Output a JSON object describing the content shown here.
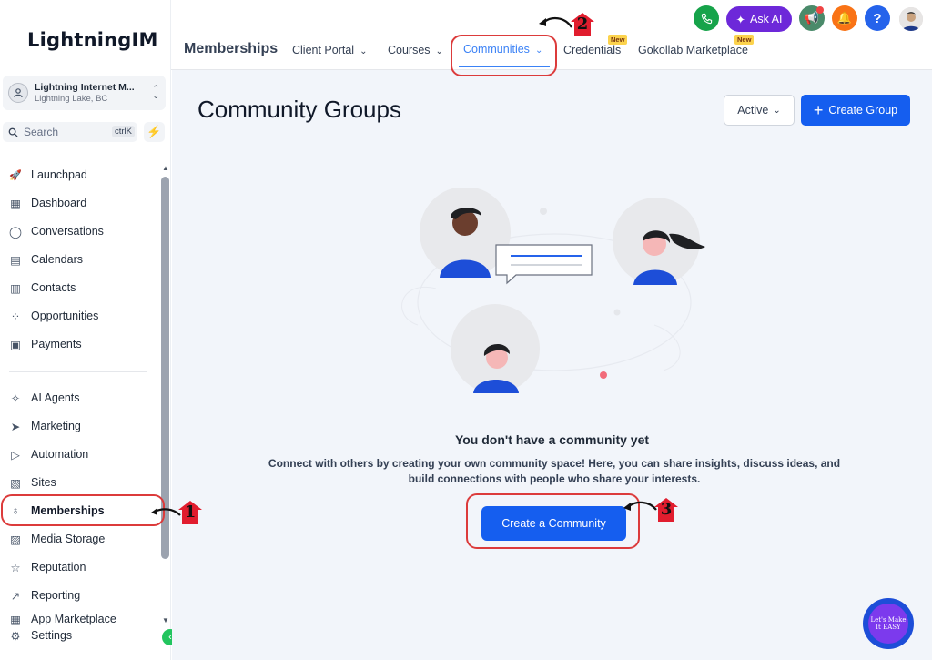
{
  "app": {
    "logo_text": "LightningIM"
  },
  "account": {
    "name": "Lightning Internet M...",
    "location": "Lightning Lake, BC"
  },
  "search": {
    "label": "Search",
    "shortcut": "ctrlK"
  },
  "sidebar": {
    "items": [
      {
        "label": "Launchpad",
        "icon": "rocket-icon"
      },
      {
        "label": "Dashboard",
        "icon": "grid-icon"
      },
      {
        "label": "Conversations",
        "icon": "chat-icon"
      },
      {
        "label": "Calendars",
        "icon": "calendar-icon"
      },
      {
        "label": "Contacts",
        "icon": "contacts-icon"
      },
      {
        "label": "Opportunities",
        "icon": "opportunities-icon"
      },
      {
        "label": "Payments",
        "icon": "payments-icon"
      },
      {
        "label": "AI Agents",
        "icon": "sparkle-icon"
      },
      {
        "label": "Marketing",
        "icon": "send-icon"
      },
      {
        "label": "Automation",
        "icon": "automation-icon"
      },
      {
        "label": "Sites",
        "icon": "sites-icon"
      },
      {
        "label": "Memberships",
        "icon": "award-icon"
      },
      {
        "label": "Media Storage",
        "icon": "image-icon"
      },
      {
        "label": "Reputation",
        "icon": "star-icon"
      },
      {
        "label": "Reporting",
        "icon": "trend-icon"
      },
      {
        "label": "App Marketplace",
        "icon": "apps-icon"
      },
      {
        "label": "Settings",
        "icon": "gear-icon"
      }
    ]
  },
  "header": {
    "section_title": "Memberships",
    "tabs": [
      {
        "label": "Client Portal"
      },
      {
        "label": "Courses"
      },
      {
        "label": "Communities"
      },
      {
        "label": "Credentials",
        "badge": "New"
      },
      {
        "label": "Gokollab Marketplace",
        "badge": "New"
      }
    ],
    "ask_ai": "Ask AI"
  },
  "main": {
    "title": "Community Groups",
    "filter_value": "Active",
    "create_group": "Create Group",
    "empty_title": "You don't have a community yet",
    "empty_text": "Connect with others by creating your own community space! Here, you can share insights, discuss ideas, and build connections with people who share your interests.",
    "create_community": "Create a Community"
  },
  "annotations": [
    "1",
    "2",
    "3"
  ],
  "fab": {
    "text": "Let's Make It EASY"
  },
  "colors": {
    "primary": "#155eef",
    "active_tab": "#3b82f6",
    "annotation_red": "#dc3b3b",
    "ask_ai": "#6d28d9"
  }
}
